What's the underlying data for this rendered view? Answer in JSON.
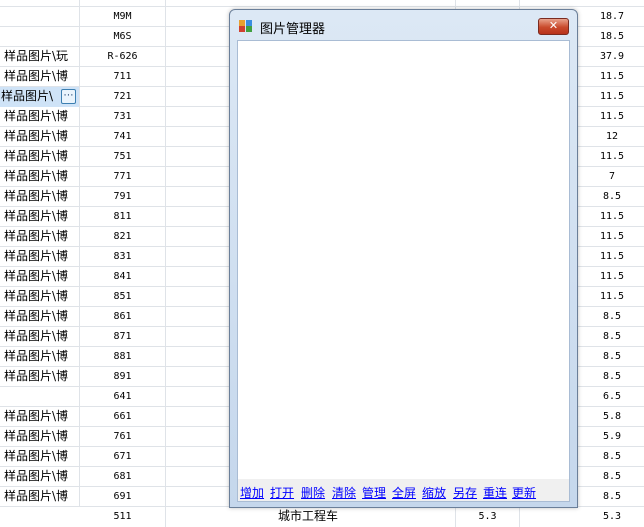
{
  "grid": {
    "rows": [
      {
        "path": "",
        "model": "M9M",
        "value": "18.7"
      },
      {
        "path": "",
        "model": "M6S",
        "value": "18.5"
      },
      {
        "path": "样品图片\\玩",
        "model": "R-626",
        "value": "37.9"
      },
      {
        "path": "样品图片\\博",
        "model": "711",
        "value": "11.5"
      },
      {
        "path": "样品图片\\",
        "model": "721",
        "value": "11.5",
        "selected": true
      },
      {
        "path": "样品图片\\博",
        "model": "731",
        "value": "11.5"
      },
      {
        "path": "样品图片\\博",
        "model": "741",
        "value": "12"
      },
      {
        "path": "样品图片\\博",
        "model": "751",
        "value": "11.5"
      },
      {
        "path": "样品图片\\博",
        "model": "771",
        "value": "7"
      },
      {
        "path": "样品图片\\博",
        "model": "791",
        "value": "8.5"
      },
      {
        "path": "样品图片\\博",
        "model": "811",
        "value": "11.5"
      },
      {
        "path": "样品图片\\博",
        "model": "821",
        "value": "11.5"
      },
      {
        "path": "样品图片\\博",
        "model": "831",
        "value": "11.5"
      },
      {
        "path": "样品图片\\博",
        "model": "841",
        "value": "11.5"
      },
      {
        "path": "样品图片\\博",
        "model": "851",
        "value": "11.5"
      },
      {
        "path": "样品图片\\博",
        "model": "861",
        "value": "8.5"
      },
      {
        "path": "样品图片\\博",
        "model": "871",
        "value": "8.5"
      },
      {
        "path": "样品图片\\博",
        "model": "881",
        "value": "8.5"
      },
      {
        "path": "样品图片\\博",
        "model": "891",
        "value": "8.5"
      },
      {
        "path": "",
        "model": "641",
        "value": "6.5"
      },
      {
        "path": "样品图片\\博",
        "model": "661",
        "value": "5.8"
      },
      {
        "path": "样品图片\\博",
        "model": "761",
        "value": "5.9"
      },
      {
        "path": "样品图片\\博",
        "model": "671",
        "value": "8.5"
      },
      {
        "path": "样品图片\\博",
        "model": "681",
        "value": "8.5"
      },
      {
        "path": "样品图片\\博",
        "model": "691",
        "value": "8.5"
      }
    ],
    "ellipsis_label": "⋯",
    "bottom_row": {
      "model": "511",
      "desc": "城市工程车",
      "mid": "5.3",
      "value": "5.3"
    }
  },
  "dialog": {
    "title": "图片管理器",
    "close_label": "✕",
    "toolbar": [
      "增加",
      "打开",
      "删除",
      "清除",
      "管理",
      "全屏",
      "缩放",
      "另存",
      "重连",
      "更新"
    ]
  },
  "colors": {
    "link": "#0000ff",
    "selection": "#cfe3f7",
    "close_button": "#c94a2c"
  }
}
